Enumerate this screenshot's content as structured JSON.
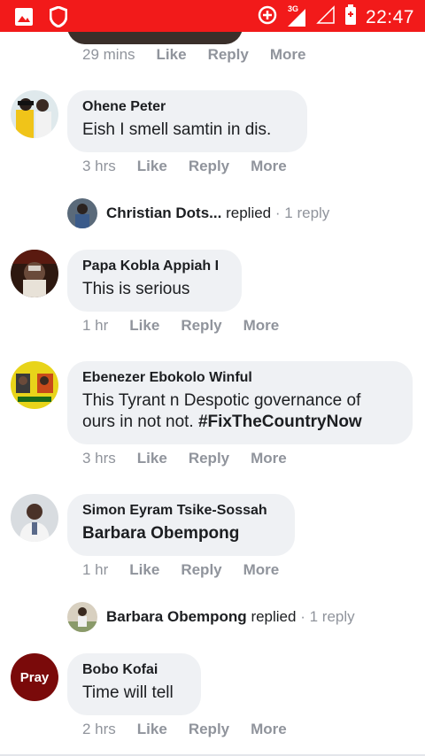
{
  "status_bar": {
    "time": "22:47",
    "network": "3G",
    "colors": {
      "background": "#f21a1a"
    },
    "icons": [
      "gallery-icon",
      "shield-icon",
      "data-saver-icon",
      "signal-3g-icon",
      "signal-empty-icon",
      "battery-charging-icon"
    ]
  },
  "previous_comment": {
    "time": "29 mins",
    "like": "Like",
    "reply": "Reply",
    "more": "More"
  },
  "comments": [
    {
      "author": "Ohene Peter",
      "text": "Eish I smell samtin in dis.",
      "time": "3 hrs",
      "like": "Like",
      "reply": "Reply",
      "more": "More",
      "replies_preview": {
        "name": "Christian Dots...",
        "action": "replied",
        "separator": "·",
        "count": "1 reply"
      }
    },
    {
      "author": "Papa Kobla Appiah I",
      "text": "This is serious",
      "time": "1 hr",
      "like": "Like",
      "reply": "Reply",
      "more": "More"
    },
    {
      "author": "Ebenezer Ebokolo Winful",
      "text_line1": "This Tyrant n Despotic governance of",
      "text_line2": "ours in not not.",
      "hashtag": "#FixTheCountryNow",
      "time": "3 hrs",
      "like": "Like",
      "reply": "Reply",
      "more": "More"
    },
    {
      "author": "Simon Eyram Tsike-Sossah",
      "mention": "Barbara Obempong",
      "time": "1 hr",
      "like": "Like",
      "reply": "Reply",
      "more": "More",
      "replies_preview": {
        "name": "Barbara Obempong",
        "action": "replied",
        "separator": "·",
        "count": "1 reply"
      }
    },
    {
      "author": "Bobo Kofai",
      "avatar_text": "Pray",
      "text": "Time will tell",
      "time": "2 hrs",
      "like": "Like",
      "reply": "Reply",
      "more": "More"
    }
  ]
}
